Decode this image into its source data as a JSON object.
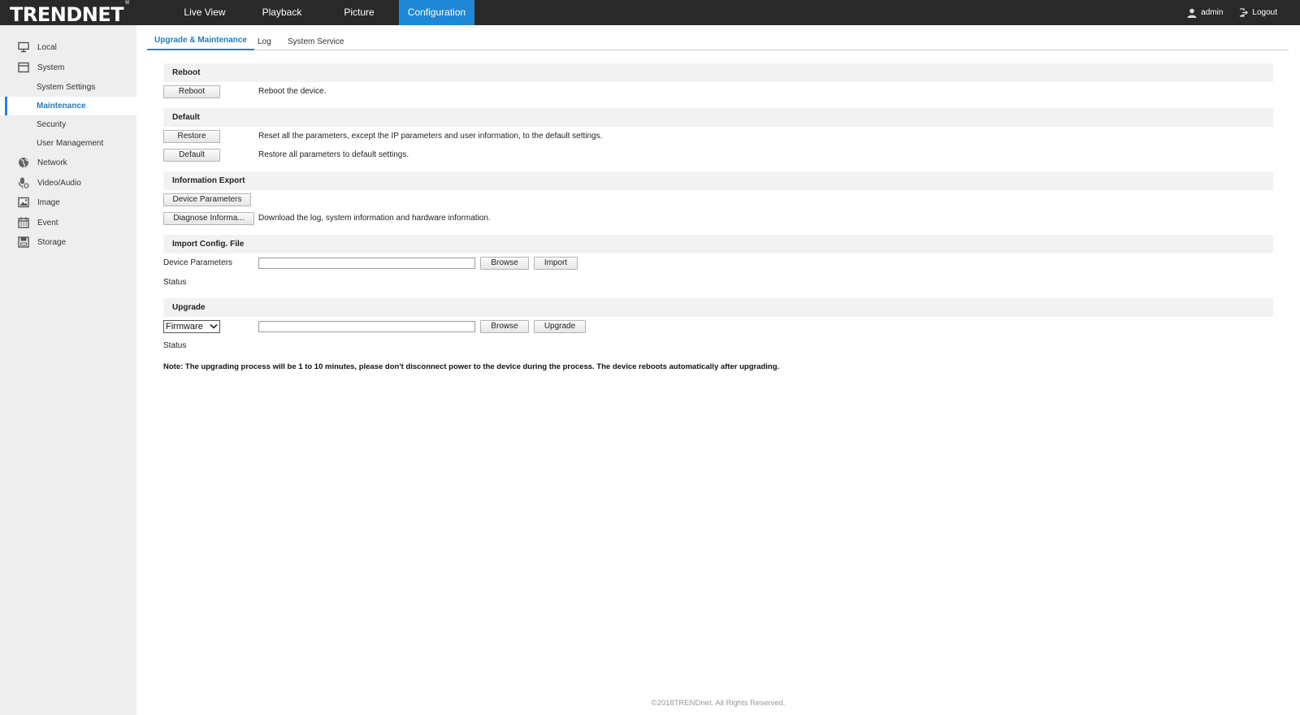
{
  "brand": {
    "logo_text": "TRENDNET",
    "logo_mark": "®"
  },
  "nav": {
    "items": [
      {
        "label": "Live View"
      },
      {
        "label": "Playback"
      },
      {
        "label": "Picture"
      },
      {
        "label": "Configuration",
        "active": true
      }
    ],
    "user": "admin",
    "logout": "Logout"
  },
  "sidebar": {
    "items": [
      {
        "label": "Local",
        "icon": "monitor-icon"
      },
      {
        "label": "System",
        "icon": "system-icon"
      },
      {
        "label": "System Settings",
        "sub": true
      },
      {
        "label": "Maintenance",
        "sub": true,
        "active": true
      },
      {
        "label": "Security",
        "sub": true
      },
      {
        "label": "User Management",
        "sub": true
      },
      {
        "label": "Network",
        "icon": "globe-icon"
      },
      {
        "label": "Video/Audio",
        "icon": "microphone-icon"
      },
      {
        "label": "Image",
        "icon": "image-icon"
      },
      {
        "label": "Event",
        "icon": "calendar-icon"
      },
      {
        "label": "Storage",
        "icon": "storage-icon"
      }
    ]
  },
  "tabs": [
    {
      "label": "Upgrade & Maintenance",
      "active": true
    },
    {
      "label": "Log"
    },
    {
      "label": "System Service"
    }
  ],
  "reboot": {
    "title": "Reboot",
    "button": "Reboot",
    "description": "Reboot the device."
  },
  "default": {
    "title": "Default",
    "restore_button": "Restore",
    "restore_description": "Reset all the parameters, except the IP parameters and user information, to the default settings.",
    "default_button": "Default",
    "default_description": "Restore all parameters to default settings."
  },
  "export": {
    "title": "Information Export",
    "device_params_button": "Device Parameters",
    "diagnose_button": "Diagnose Informa...",
    "diagnose_description": "Download the log, system information and hardware information."
  },
  "import_config": {
    "title": "Import Config. File",
    "field_label": "Device Parameters",
    "file_value": "",
    "browse_button": "Browse",
    "import_button": "Import",
    "status_label": "Status"
  },
  "upgrade": {
    "title": "Upgrade",
    "type_selected": "Firmware",
    "file_value": "",
    "browse_button": "Browse",
    "upgrade_button": "Upgrade",
    "status_label": "Status",
    "note": "Note: The upgrading process will be 1 to 10 minutes, please don't disconnect power to the device during the process. The device reboots automatically after upgrading."
  },
  "footer": "©2018TRENDnet. All Rights Reserved.",
  "colors": {
    "topbar": "#292929",
    "accent": "#1e87d6",
    "sidebar": "#eeeeee",
    "section": "#f2f2f2"
  }
}
